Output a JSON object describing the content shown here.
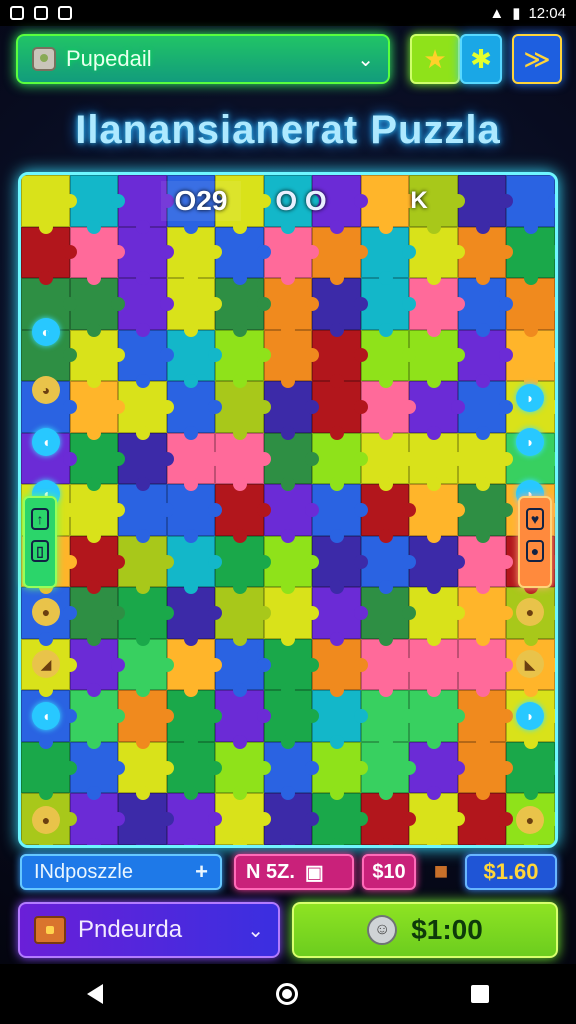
{
  "status": {
    "time": "12:04"
  },
  "header": {
    "selector_label": "Pupedail",
    "title": "Ilanansianerat Puzzla"
  },
  "board": {
    "score_left": "O29",
    "score_mid": "O O",
    "score_right": "K"
  },
  "bottom": {
    "name_label": "INdposzzle",
    "name_plus": "+",
    "pn_label": "N 5Z.",
    "s_label": "$10",
    "price_label": "$1.60",
    "dropdown_label": "Pndeurda",
    "buy_label": "$1:00"
  },
  "colors": {
    "accent_green": "#59ff3e",
    "accent_cyan": "#6ff7ff",
    "accent_blue": "#1e5fe0",
    "accent_magenta": "#c9217a",
    "accent_purple": "#6a1fd8"
  },
  "icons": {
    "selector": "puzzle-box-icon",
    "star": "star-icon",
    "cross": "crosshair-icon",
    "check": "double-chevron-icon"
  }
}
